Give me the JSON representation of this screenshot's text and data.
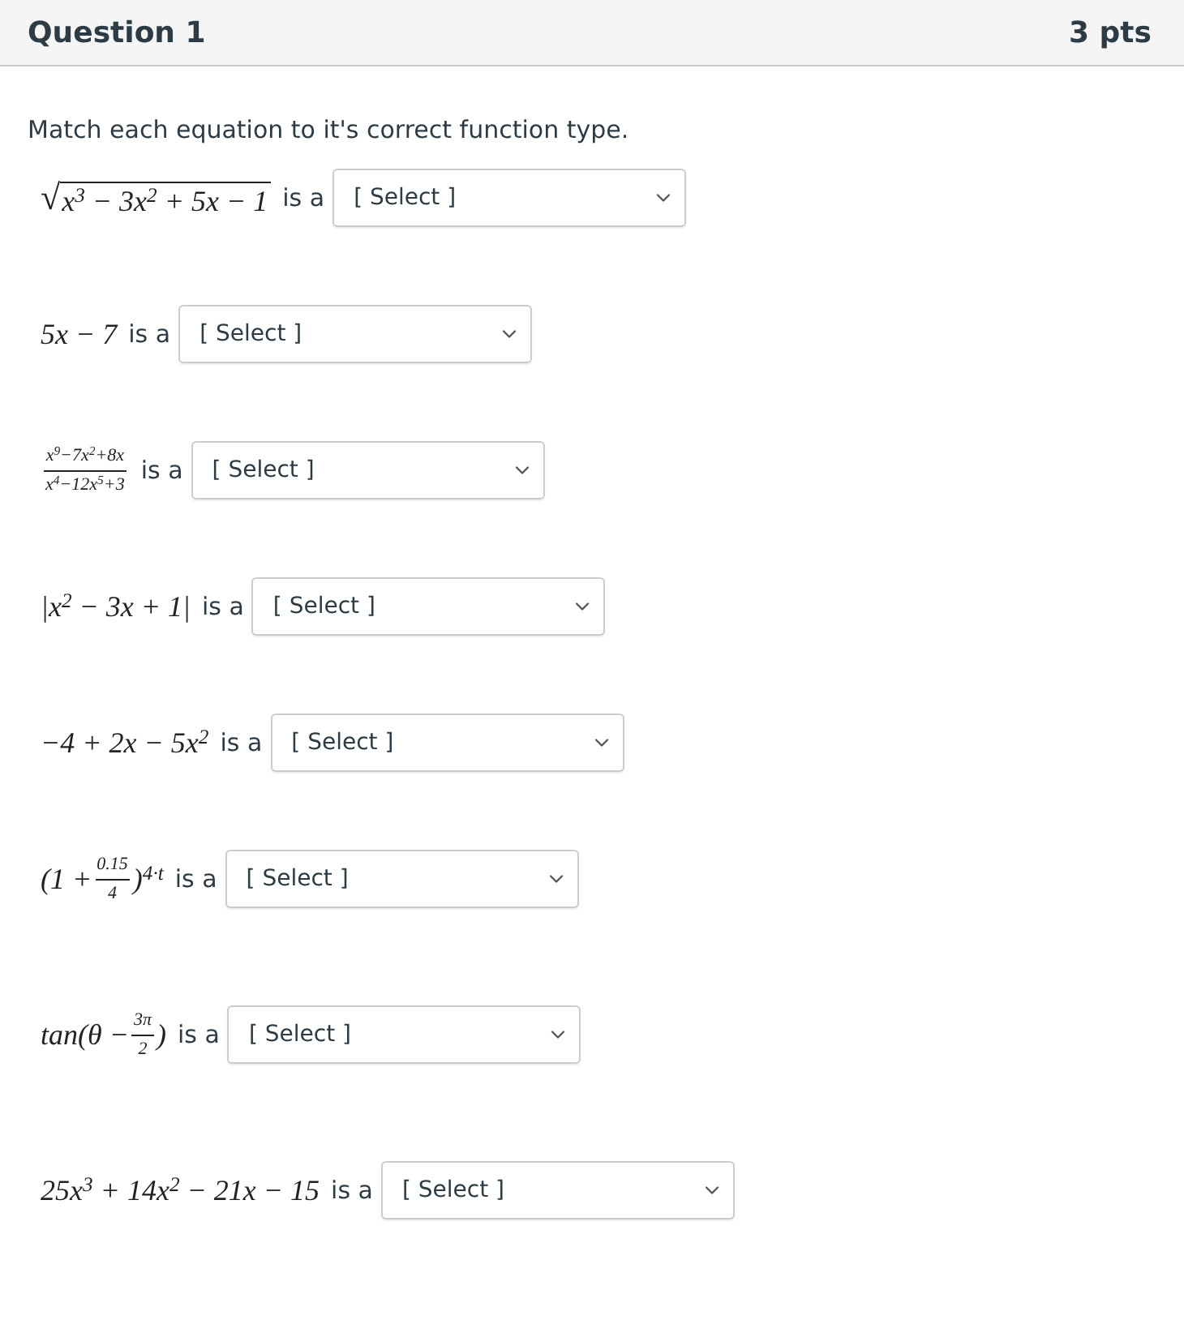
{
  "header": {
    "title": "Question 1",
    "points": "3 pts"
  },
  "prompt": "Match each equation to it's correct function type.",
  "rows": [
    {
      "expression": [
        {
          "kind": "sqrt",
          "radical": "√",
          "text": "x$^{3}$ − 3x$^{2}$ + 5x − 1"
        }
      ],
      "connector": "is a",
      "select": "[ Select ]"
    },
    {
      "expression": [
        {
          "kind": "text",
          "text": "5x − 7"
        }
      ],
      "connector": "is a",
      "select": "[ Select ]"
    },
    {
      "expression": [
        {
          "kind": "frac",
          "numerator": "x$^{9}$−7x$^{2}$+8x",
          "denominator": "x$^{4}$−12x$^{5}$+3"
        }
      ],
      "connector": "is a",
      "select": "[ Select ]"
    },
    {
      "expression": [
        {
          "kind": "text",
          "text": "|x$^{2}$ − 3x + 1|"
        }
      ],
      "connector": "is a",
      "select": "[ Select ]"
    },
    {
      "expression": [
        {
          "kind": "text",
          "text": "−4 + 2x − 5x$^{2}$"
        }
      ],
      "connector": "is a",
      "select": "[ Select ]"
    },
    {
      "expression": [
        {
          "kind": "text",
          "text": "(1 + "
        },
        {
          "kind": "frac",
          "numerator": "0.15",
          "denominator": "4"
        },
        {
          "kind": "text",
          "text": ")$^{4·t}$"
        }
      ],
      "connector": "is a",
      "select": "[ Select ]"
    },
    {
      "expression": [
        {
          "kind": "text",
          "text": "tan(θ − "
        },
        {
          "kind": "frac",
          "numerator": "3π",
          "denominator": "2"
        },
        {
          "kind": "text",
          "text": ")"
        }
      ],
      "connector": "is a",
      "select": "[ Select ]"
    },
    {
      "expression": [
        {
          "kind": "text",
          "text": "25x$^{3}$ + 14x$^{2}$ − 21x − 15"
        }
      ],
      "connector": "is a",
      "select": "[ Select ]"
    }
  ]
}
